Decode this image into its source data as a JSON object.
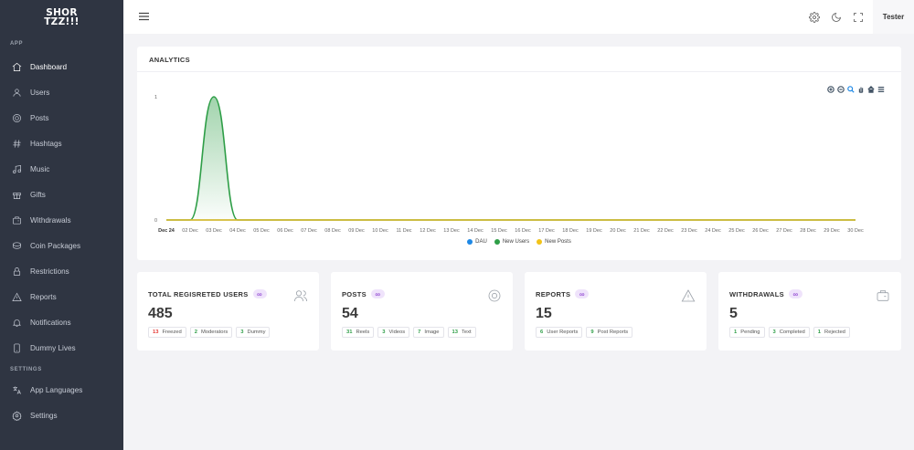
{
  "brand": {
    "line1": "SHOR",
    "line2": "TZZ!!!"
  },
  "sidebar": {
    "section_app": "APP",
    "section_settings": "SETTINGS",
    "items": [
      {
        "label": "Dashboard",
        "icon": "home-icon"
      },
      {
        "label": "Users",
        "icon": "user-icon"
      },
      {
        "label": "Posts",
        "icon": "aperture-icon"
      },
      {
        "label": "Hashtags",
        "icon": "hash-icon"
      },
      {
        "label": "Music",
        "icon": "music-icon"
      },
      {
        "label": "Gifts",
        "icon": "gift-icon"
      },
      {
        "label": "Withdrawals",
        "icon": "wallet-icon"
      },
      {
        "label": "Coin Packages",
        "icon": "coins-icon"
      },
      {
        "label": "Restrictions",
        "icon": "lock-icon"
      },
      {
        "label": "Reports",
        "icon": "alert-icon"
      },
      {
        "label": "Notifications",
        "icon": "bell-icon"
      },
      {
        "label": "Dummy Lives",
        "icon": "phone-icon"
      }
    ],
    "settings_items": [
      {
        "label": "App Languages",
        "icon": "translate-icon"
      },
      {
        "label": "Settings",
        "icon": "gear-icon"
      }
    ]
  },
  "topbar": {
    "user": "Tester"
  },
  "analytics": {
    "title": "ANALYTICS",
    "legend": [
      {
        "name": "DAU",
        "color": "#1e88e5"
      },
      {
        "name": "New Users",
        "color": "#2e9e47"
      },
      {
        "name": "New Posts",
        "color": "#f2c318"
      }
    ]
  },
  "chart_data": {
    "type": "area",
    "x": [
      "Dec 24",
      "02 Dec",
      "03 Dec",
      "04 Dec",
      "05 Dec",
      "06 Dec",
      "07 Dec",
      "08 Dec",
      "09 Dec",
      "10 Dec",
      "11 Dec",
      "12 Dec",
      "13 Dec",
      "14 Dec",
      "15 Dec",
      "16 Dec",
      "17 Dec",
      "18 Dec",
      "19 Dec",
      "20 Dec",
      "21 Dec",
      "22 Dec",
      "23 Dec",
      "24 Dec",
      "25 Dec",
      "26 Dec",
      "27 Dec",
      "28 Dec",
      "29 Dec",
      "30 Dec"
    ],
    "yticks": [
      "1",
      "0"
    ],
    "ylim": [
      0,
      1
    ],
    "series": [
      {
        "name": "DAU",
        "color": "#1e88e5",
        "values": [
          0,
          0,
          0,
          0,
          0,
          0,
          0,
          0,
          0,
          0,
          0,
          0,
          0,
          0,
          0,
          0,
          0,
          0,
          0,
          0,
          0,
          0,
          0,
          0,
          0,
          0,
          0,
          0,
          0,
          0
        ]
      },
      {
        "name": "New Users",
        "color": "#2e9e47",
        "values": [
          0,
          0,
          1,
          0,
          0,
          0,
          0,
          0,
          0,
          0,
          0,
          0,
          0,
          0,
          0,
          0,
          0,
          0,
          0,
          0,
          0,
          0,
          0,
          0,
          0,
          0,
          0,
          0,
          0,
          0
        ]
      },
      {
        "name": "New Posts",
        "color": "#f2c318",
        "values": [
          0,
          0,
          0,
          0,
          0,
          0,
          0,
          0,
          0,
          0,
          0,
          0,
          0,
          0,
          0,
          0,
          0,
          0,
          0,
          0,
          0,
          0,
          0,
          0,
          0,
          0,
          0,
          0,
          0,
          0
        ]
      }
    ],
    "grid": false,
    "legend_position": "bottom"
  },
  "stats": [
    {
      "title": "TOTAL REGISRETED USERS",
      "value": "485",
      "icon": "users-icon",
      "pills": [
        {
          "n": "13",
          "label": "Freezed",
          "color": "#e53935"
        },
        {
          "n": "2",
          "label": "Moderators",
          "color": "#2e9e47"
        },
        {
          "n": "3",
          "label": "Dummy",
          "color": "#2e9e47"
        }
      ]
    },
    {
      "title": "POSTS",
      "value": "54",
      "icon": "aperture-icon",
      "pills": [
        {
          "n": "31",
          "label": "Reels",
          "color": "#2e9e47"
        },
        {
          "n": "3",
          "label": "Videos",
          "color": "#2e9e47"
        },
        {
          "n": "7",
          "label": "Image",
          "color": "#2e9e47"
        },
        {
          "n": "13",
          "label": "Text",
          "color": "#2e9e47"
        }
      ]
    },
    {
      "title": "REPORTS",
      "value": "15",
      "icon": "alert-icon",
      "pills": [
        {
          "n": "6",
          "label": "User Reports",
          "color": "#2e9e47"
        },
        {
          "n": "9",
          "label": "Post Reports",
          "color": "#2e9e47"
        }
      ]
    },
    {
      "title": "WITHDRAWALS",
      "value": "5",
      "icon": "wallet-icon",
      "pills": [
        {
          "n": "1",
          "label": "Pending",
          "color": "#2e9e47"
        },
        {
          "n": "3",
          "label": "Completed",
          "color": "#2e9e47"
        },
        {
          "n": "1",
          "label": "Rejected",
          "color": "#2e9e47"
        }
      ]
    }
  ],
  "infinity_symbol": "∞"
}
